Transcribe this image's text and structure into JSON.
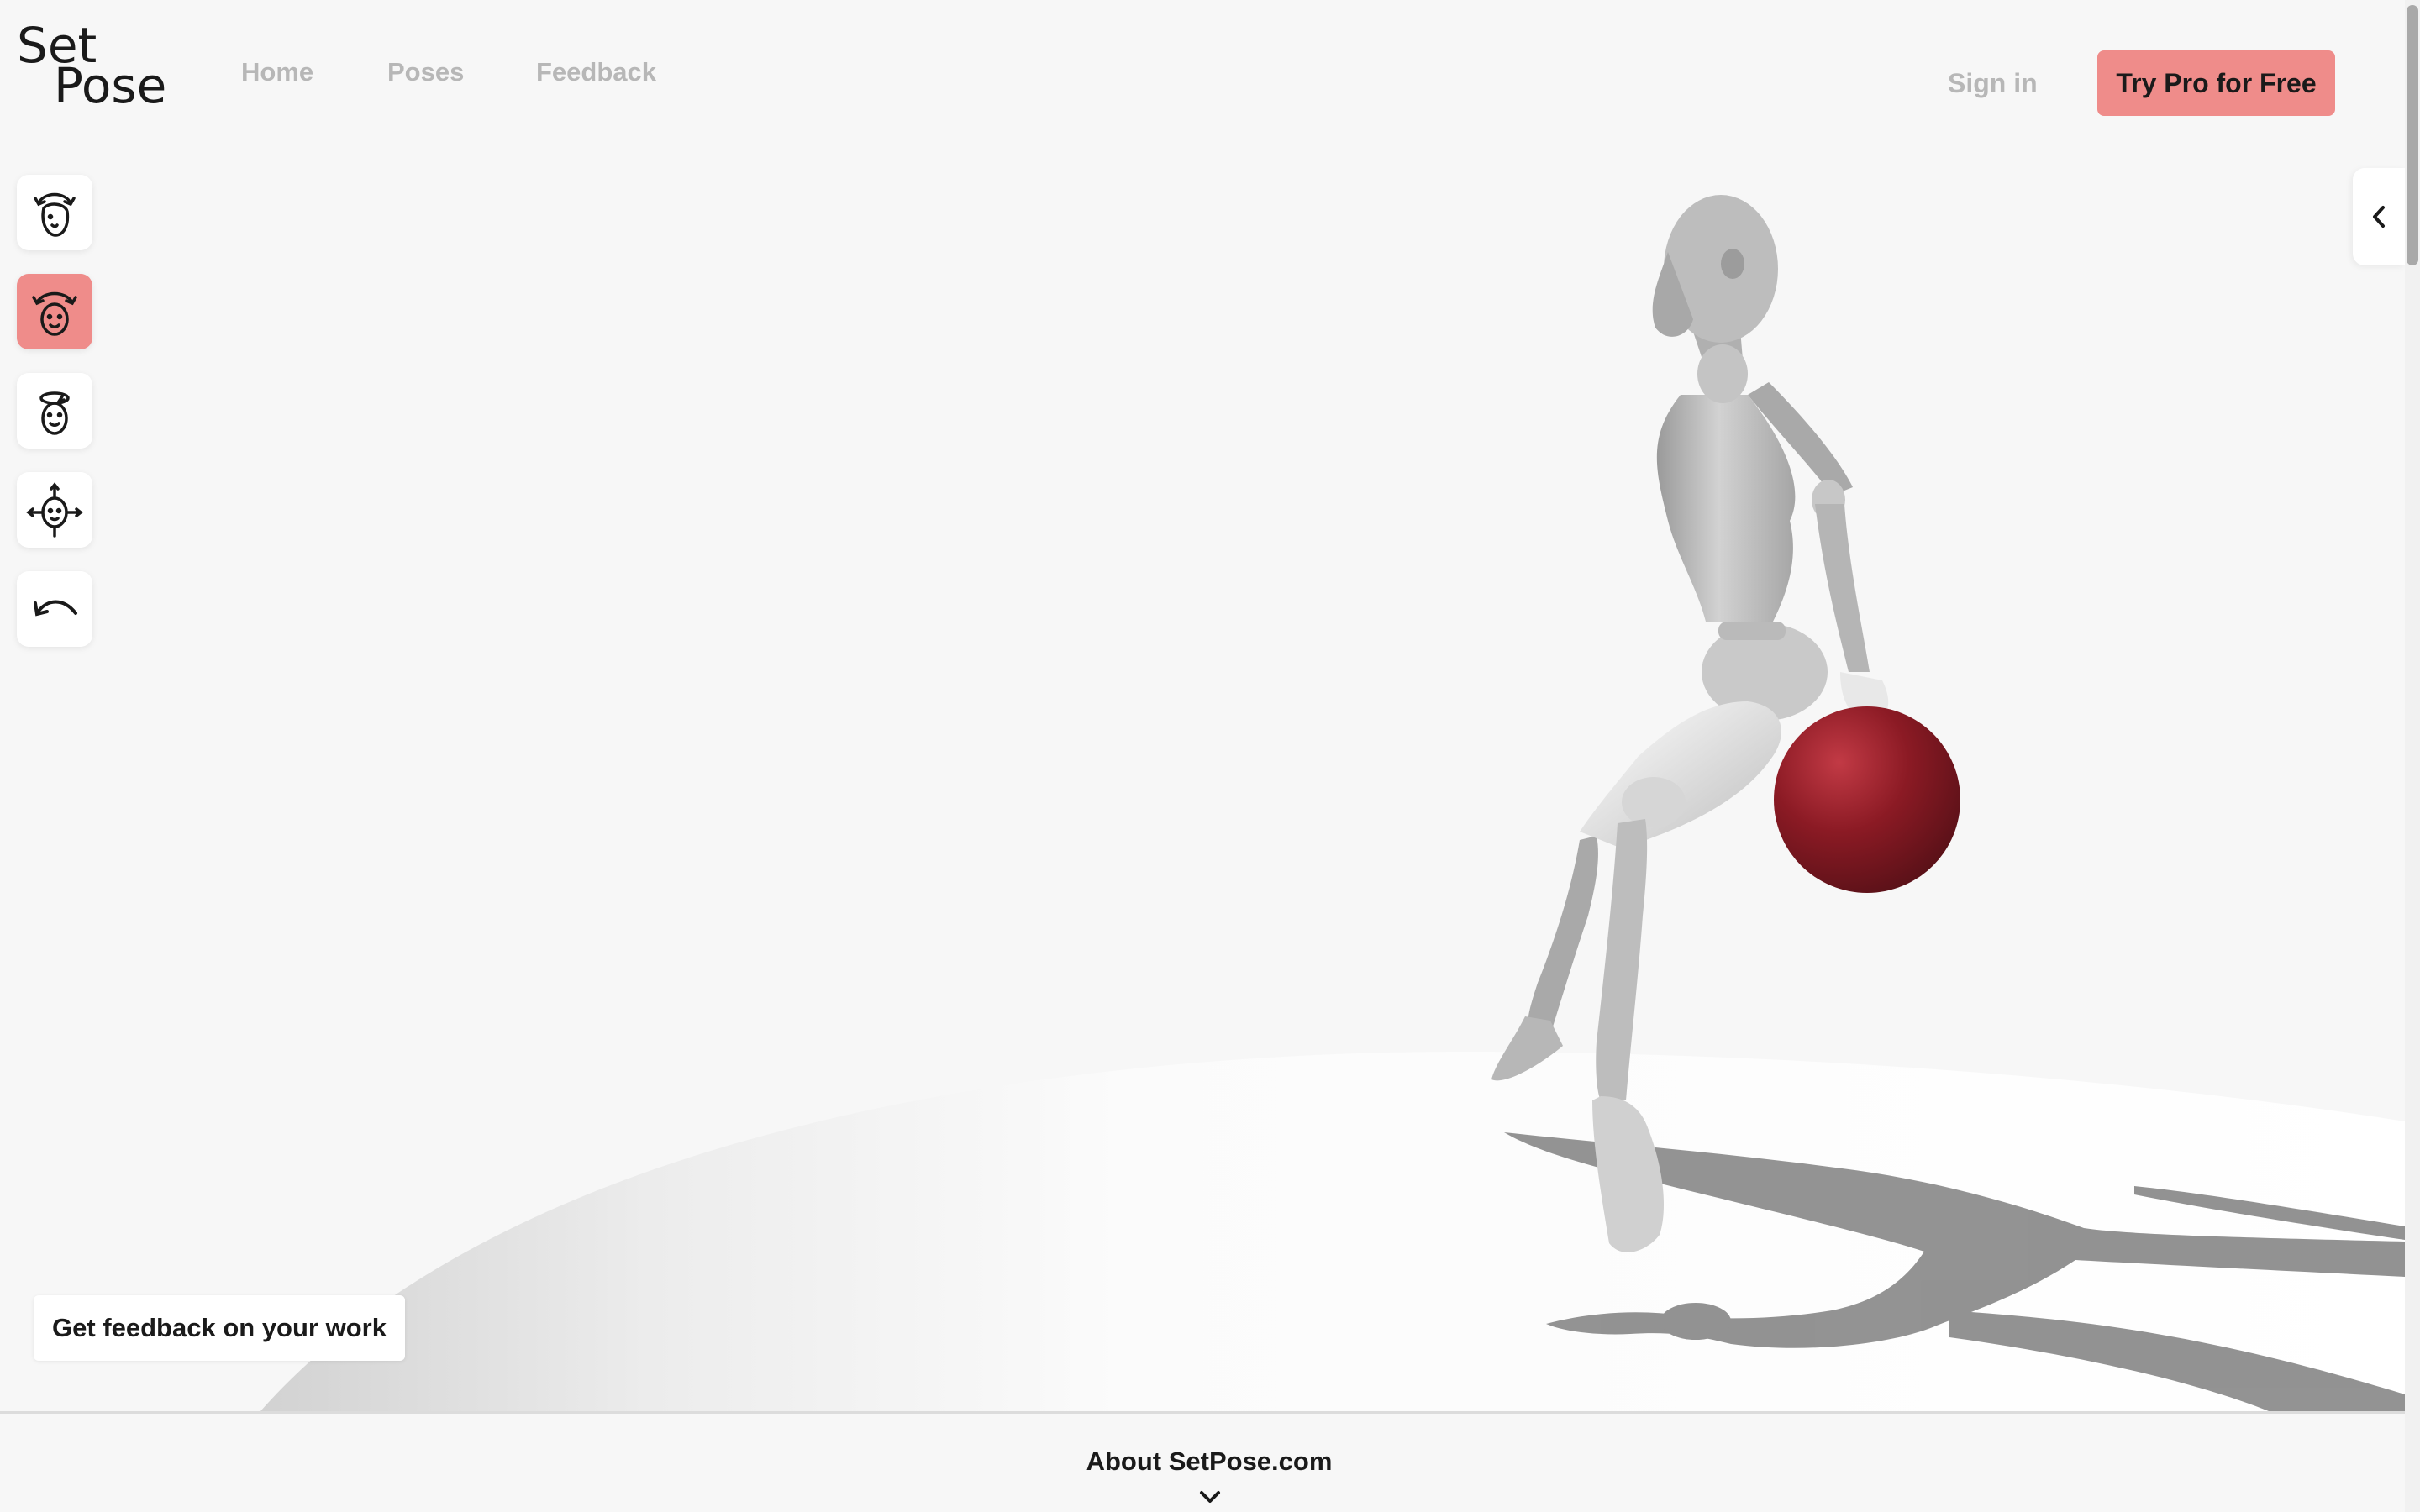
{
  "brand": {
    "logo_top": "Set",
    "logo_bottom": "Pose",
    "accent_color": "#ef8c8a",
    "ball_color": "#8b1a24"
  },
  "nav": {
    "home": "Home",
    "poses": "Poses",
    "feedback": "Feedback"
  },
  "header": {
    "sign_in": "Sign in",
    "try_pro": "Try Pro for Free"
  },
  "toolbar": {
    "tools": [
      {
        "icon": "rotate-head-icon",
        "active": false
      },
      {
        "icon": "rotate-body-icon",
        "active": true
      },
      {
        "icon": "tilt-head-icon",
        "active": false
      },
      {
        "icon": "move-icon",
        "active": false
      },
      {
        "icon": "undo-icon",
        "active": false
      }
    ]
  },
  "panel_toggle": {
    "icon": "chevron-left-icon"
  },
  "feedback_cta": "Get feedback on your work",
  "footer": {
    "about": "About SetPose.com",
    "chevron_icon": "chevron-down-icon"
  }
}
